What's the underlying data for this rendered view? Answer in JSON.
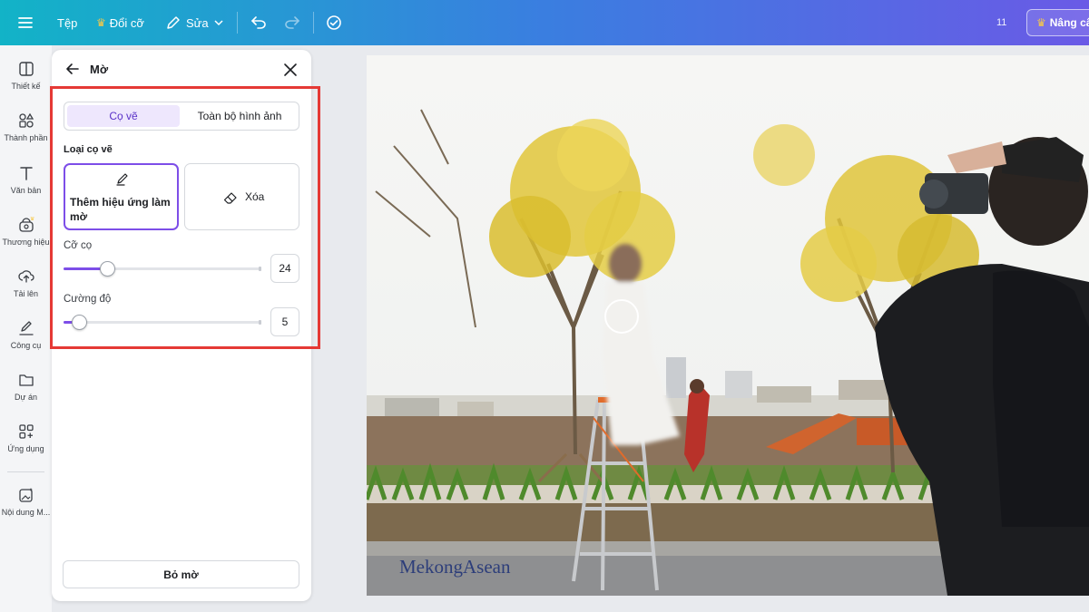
{
  "topbar": {
    "menu_icon": "hamburger-icon",
    "file": "Tệp",
    "resize": "Đổi cỡ",
    "edit": "Sửa",
    "count": "11",
    "upgrade": "Nâng cấ",
    "accent_crown": "#f7c948"
  },
  "rail": {
    "items": [
      {
        "label": "Thiết kế",
        "icon": "layout-icon"
      },
      {
        "label": "Thành phần",
        "icon": "elements-icon"
      },
      {
        "label": "Văn bản",
        "icon": "text-icon"
      },
      {
        "label": "Thương hiệu",
        "icon": "brand-icon"
      },
      {
        "label": "Tải lên",
        "icon": "upload-icon"
      },
      {
        "label": "Công cụ",
        "icon": "draw-icon"
      },
      {
        "label": "Dự án",
        "icon": "folder-icon"
      },
      {
        "label": "Ứng dụng",
        "icon": "apps-icon"
      },
      {
        "label": "Nội dung M...",
        "icon": "magic-media-icon"
      }
    ]
  },
  "panel": {
    "title": "Mờ",
    "tabs": [
      "Cọ vẽ",
      "Toàn bộ hình ảnh"
    ],
    "active_tab": "Cọ vẽ",
    "brush_type_label": "Loại cọ vẽ",
    "brush_add": "Thêm hiệu ứng làm mờ",
    "brush_erase": "Xóa",
    "size_label": "Cỡ cọ",
    "size_value": "24",
    "size_fraction": 0.22,
    "intensity_label": "Cường độ",
    "intensity_value": "5",
    "intensity_fraction": 0.08,
    "remove_button": "Bỏ mờ",
    "accent": "#7d4ee8",
    "highlight_color": "#e53935"
  },
  "canvas": {
    "watermark": "MekongAsean"
  }
}
